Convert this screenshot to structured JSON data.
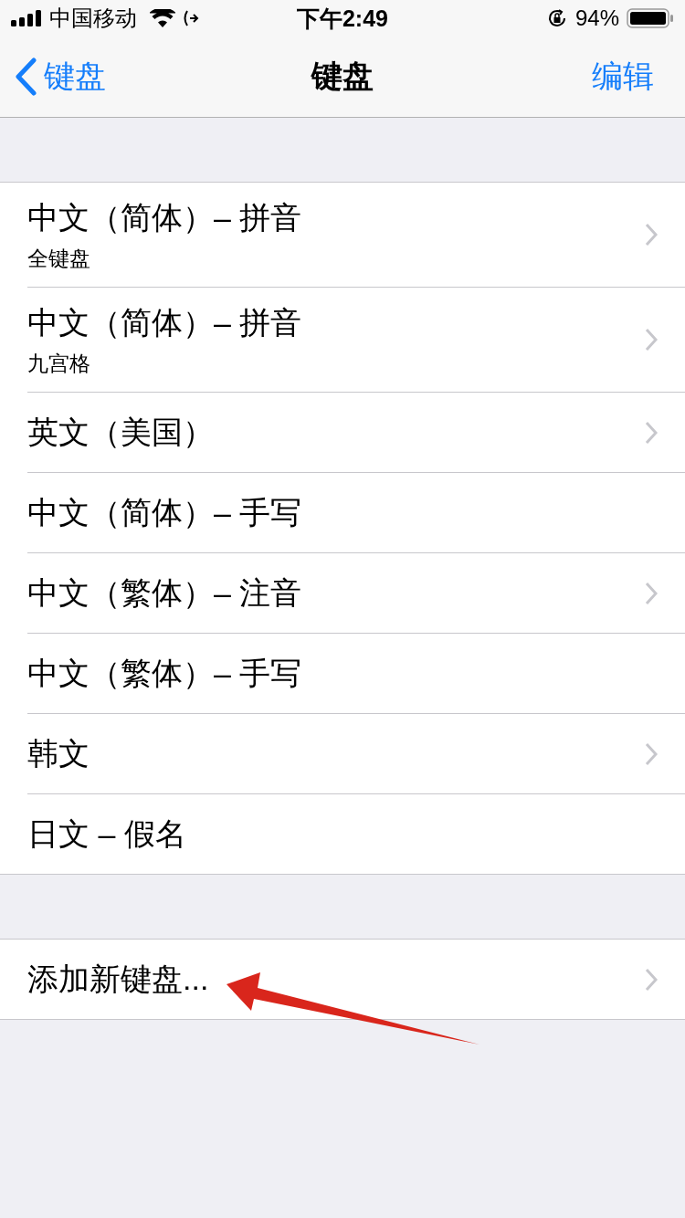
{
  "status_bar": {
    "carrier": "中国移动",
    "time": "下午2:49",
    "battery": "94%"
  },
  "nav_bar": {
    "back": "键盘",
    "title": "键盘",
    "action": "编辑"
  },
  "keyboards": [
    {
      "title": "中文（简体）– 拼音",
      "subtitle": "全键盘",
      "chevron": true
    },
    {
      "title": "中文（简体）– 拼音",
      "subtitle": "九宫格",
      "chevron": true
    },
    {
      "title": "英文（美国）",
      "chevron": true
    },
    {
      "title": "中文（简体）– 手写",
      "chevron": false
    },
    {
      "title": "中文（繁体）– 注音",
      "chevron": true
    },
    {
      "title": "中文（繁体）– 手写",
      "chevron": false
    },
    {
      "title": "韩文",
      "chevron": true
    },
    {
      "title": "日文 – 假名",
      "chevron": false
    }
  ],
  "add_keyboard": {
    "title": "添加新键盘...",
    "chevron": true
  }
}
